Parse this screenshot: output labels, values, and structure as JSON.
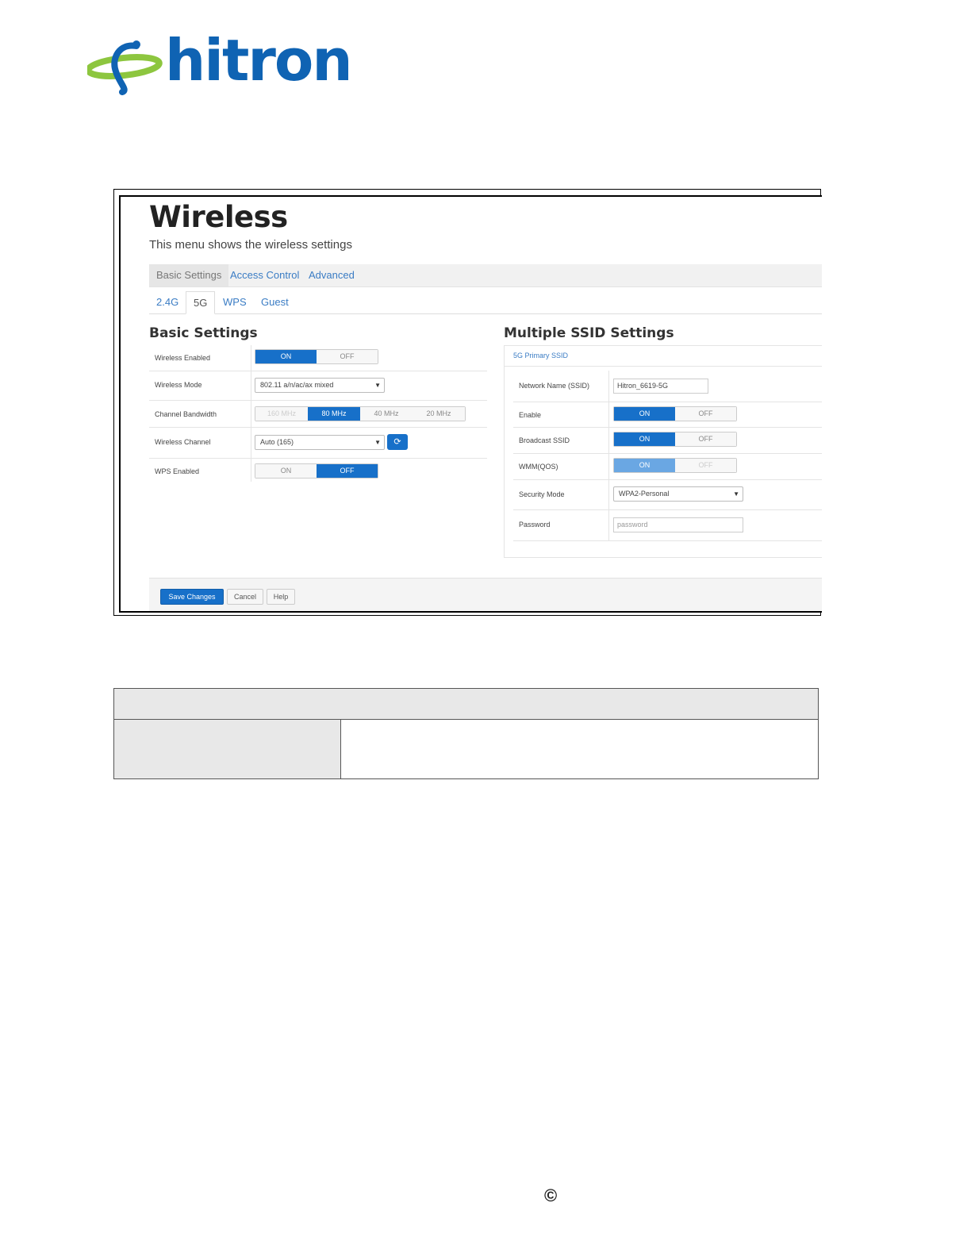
{
  "logo": {
    "text": "hitron"
  },
  "screen": {
    "title": "Wireless",
    "subtitle": "This menu shows the wireless settings",
    "main_tabs": [
      {
        "label": "Basic Settings",
        "active": true
      },
      {
        "label": "Access Control",
        "active": false
      },
      {
        "label": "Advanced",
        "active": false
      }
    ],
    "band_tabs": [
      {
        "label": "2.4G",
        "active": false
      },
      {
        "label": "5G",
        "active": true
      },
      {
        "label": "WPS",
        "active": false
      },
      {
        "label": "Guest",
        "active": false
      }
    ],
    "basic": {
      "heading": "Basic Settings",
      "wireless_enabled": {
        "label": "Wireless Enabled",
        "on": "ON",
        "off": "OFF"
      },
      "wireless_mode": {
        "label": "Wireless Mode",
        "value": "802.11 a/n/ac/ax mixed"
      },
      "channel_bandwidth": {
        "label": "Channel Bandwidth",
        "options": [
          "160 MHz",
          "80 MHz",
          "40 MHz",
          "20 MHz"
        ],
        "selected": "80 MHz"
      },
      "wireless_channel": {
        "label": "Wireless Channel",
        "value": "Auto (165)"
      },
      "wps_enabled": {
        "label": "WPS Enabled",
        "on": "ON",
        "off": "OFF"
      }
    },
    "ssid": {
      "heading": "Multiple SSID Settings",
      "subheading": "5G Primary SSID",
      "network_name": {
        "label": "Network Name (SSID)",
        "value": "Hitron_6619-5G"
      },
      "enable": {
        "label": "Enable",
        "on": "ON",
        "off": "OFF"
      },
      "broadcast": {
        "label": "Broadcast SSID",
        "on": "ON",
        "off": "OFF"
      },
      "wmm": {
        "label": "WMM(QOS)",
        "on": "ON",
        "off": "OFF"
      },
      "security_mode": {
        "label": "Security Mode",
        "value": "WPA2-Personal"
      },
      "password": {
        "label": "Password",
        "placeholder": "password"
      }
    },
    "buttons": {
      "save": "Save Changes",
      "cancel": "Cancel",
      "help": "Help"
    }
  },
  "footer": {
    "copyright_symbol": "©"
  },
  "icons": {
    "refresh": "refresh-icon",
    "dropdown": "chevron-down-icon"
  },
  "colors": {
    "accent": "#1770c9",
    "logo_blue": "#0f63b3",
    "logo_green": "#8dc63f"
  }
}
